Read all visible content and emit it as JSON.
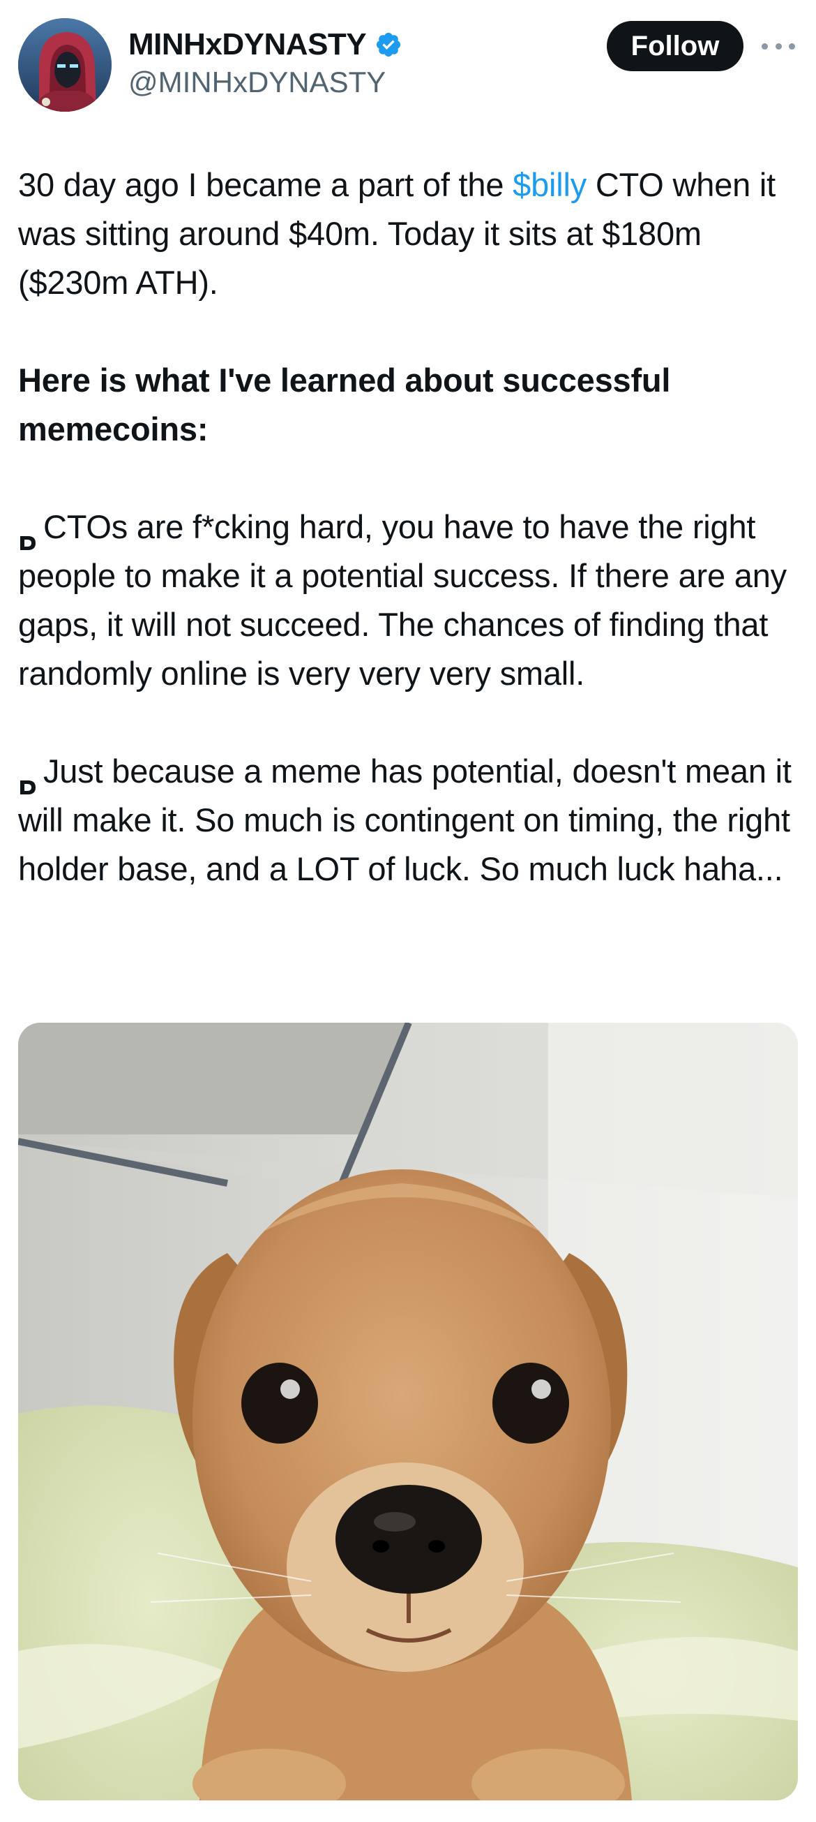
{
  "author": {
    "display_name": "MINHxDYNASTY",
    "handle": "@MINHxDYNASTY",
    "verified": true,
    "avatar_icon": "hooded-figure-avatar"
  },
  "actions": {
    "follow_label": "Follow",
    "more_icon": "more-horizontal-icon"
  },
  "tweet": {
    "p1_before": "30 day ago I became a part of the ",
    "p1_cashtag": "$billy",
    "p1_after": " CTO when it was sitting around $40m. Today it sits at $180m ($230m ATH).",
    "heading": "Here is what I've learned about successful memecoins:",
    "bullet1": "CTOs are f*cking hard, you have to have the right people to make it a potential success. If there are any gaps, it will not succeed. The chances of finding that randomly online is very very very small.",
    "bullet2": "Just because a meme has potential, doesn't mean it will make it. So much is contingent on timing, the right holder base, and a LOT of luck. So much luck haha..."
  },
  "media": {
    "icon": "puppy-photo"
  },
  "colors": {
    "link": "#1d9bf0",
    "text": "#0f1419",
    "secondary": "#536471",
    "verified": "#1d9bf0"
  }
}
